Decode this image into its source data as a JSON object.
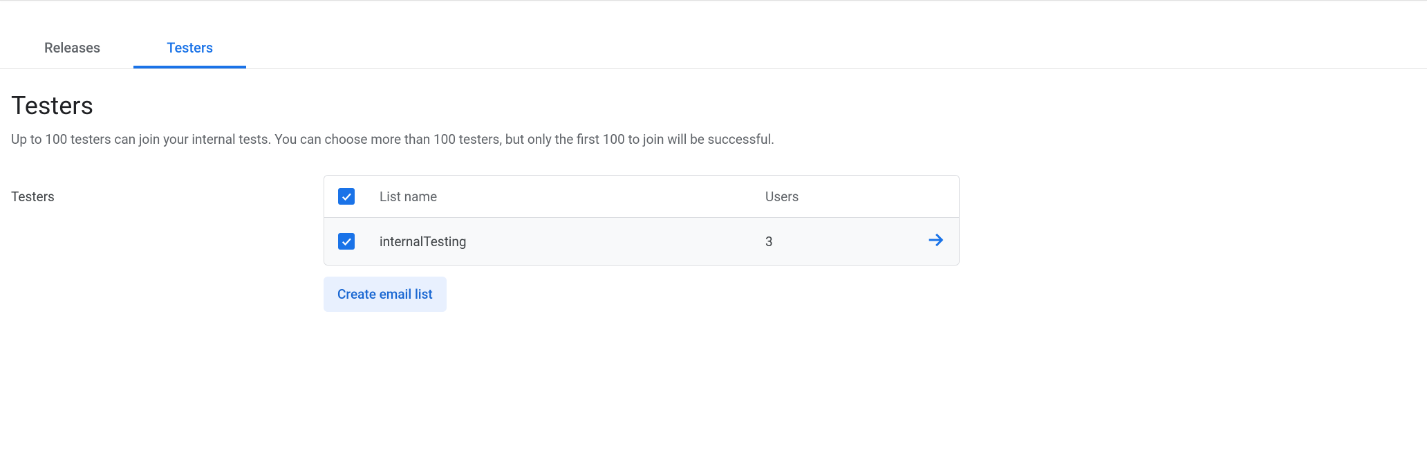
{
  "tabs": [
    {
      "label": "Releases",
      "active": false
    },
    {
      "label": "Testers",
      "active": true
    }
  ],
  "page": {
    "title": "Testers",
    "description": "Up to 100 testers can join your internal tests. You can choose more than 100 testers, but only the first 100 to join will be successful."
  },
  "section": {
    "label": "Testers"
  },
  "table": {
    "headers": {
      "name": "List name",
      "users": "Users"
    },
    "rows": [
      {
        "name": "internalTesting",
        "users": "3",
        "checked": true
      }
    ]
  },
  "buttons": {
    "create_email_list": "Create email list"
  }
}
